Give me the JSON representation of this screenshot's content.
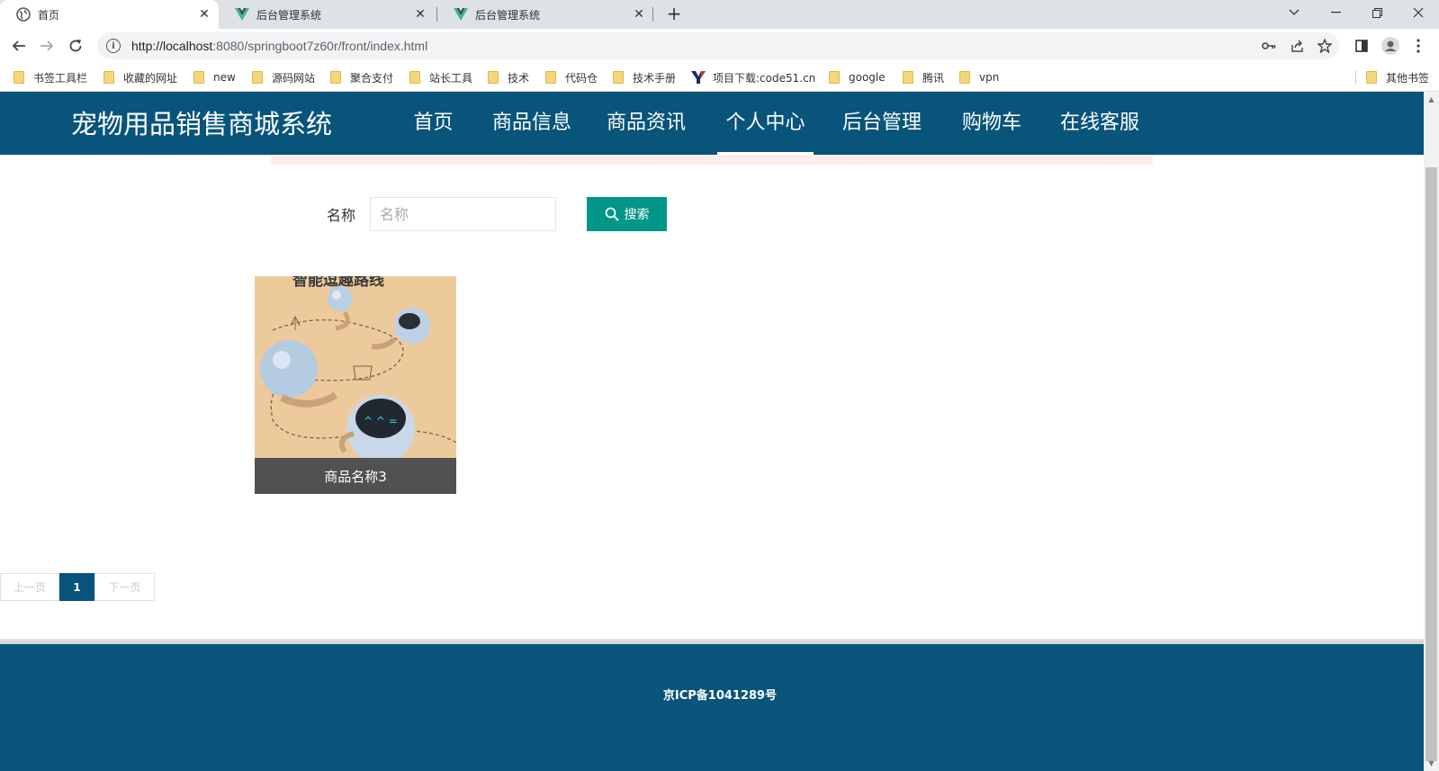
{
  "browser": {
    "tabs": [
      {
        "title": "首页",
        "icon": "globe-icon",
        "active": true
      },
      {
        "title": "后台管理系统",
        "icon": "vue-icon",
        "active": false
      },
      {
        "title": "后台管理系统",
        "icon": "vue-icon",
        "active": false
      }
    ],
    "new_tab": "+",
    "url_host": "http://localhost",
    "url_rest": ":8080/springboot7z60r/front/index.html",
    "bookmarks": [
      "书签工具栏",
      "收藏的网址",
      "new",
      "源码网站",
      "聚合支付",
      "站长工具",
      "技术",
      "代码仓",
      "技术手册",
      "项目下载:code51.cn",
      "google",
      "腾讯",
      "vpn"
    ],
    "other_bookmarks": "其他书签"
  },
  "site": {
    "title": "宠物用品销售商城系统",
    "menu": [
      "首页",
      "商品信息",
      "商品资讯",
      "个人中心",
      "后台管理",
      "购物车",
      "在线客服"
    ],
    "active_menu": "个人中心",
    "colors": {
      "primary": "#09547b",
      "search_btn": "#009688"
    }
  },
  "search": {
    "label": "名称",
    "placeholder": "名称",
    "button": "搜索"
  },
  "products": [
    {
      "name": "商品名称3",
      "image_caption": "智能逗趣路线"
    }
  ],
  "pagination": {
    "prev": "上一页",
    "current": "1",
    "next": "下一页"
  },
  "footer": {
    "icp": "京ICP备1041289号"
  }
}
